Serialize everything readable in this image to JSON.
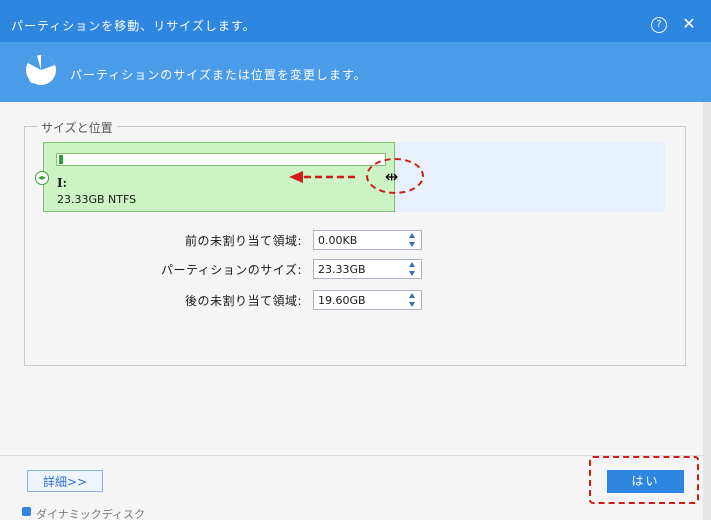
{
  "window": {
    "title": "パーティションを移動、リサイズします。",
    "help_glyph": "?",
    "close_glyph": "✕",
    "accent_color": "#2f86e0",
    "banner_color": "#4a9be8"
  },
  "banner": {
    "description": "パーティションのサイズまたは位置を変更します。",
    "icon": "partition-resize-icon"
  },
  "group": {
    "label": "サイズと位置"
  },
  "partition": {
    "drive": "I:",
    "info": "23.33GB NTFS",
    "color": "#cdf2c4",
    "used_fraction": 0.01
  },
  "fields": [
    {
      "label": "前の未割り当て領域:",
      "value": "0.00KB"
    },
    {
      "label": "パーティションのサイズ:",
      "value": "23.33GB"
    },
    {
      "label": "後の未割り当て領域:",
      "value": "19.60GB"
    }
  ],
  "buttons": {
    "detail": "詳細>>",
    "ok": "はい"
  },
  "annotations": {
    "highlight_color": "#d11b1b",
    "cursor_glyph": "⇹"
  },
  "background_window": {
    "text": "ダイナミックディスク"
  }
}
